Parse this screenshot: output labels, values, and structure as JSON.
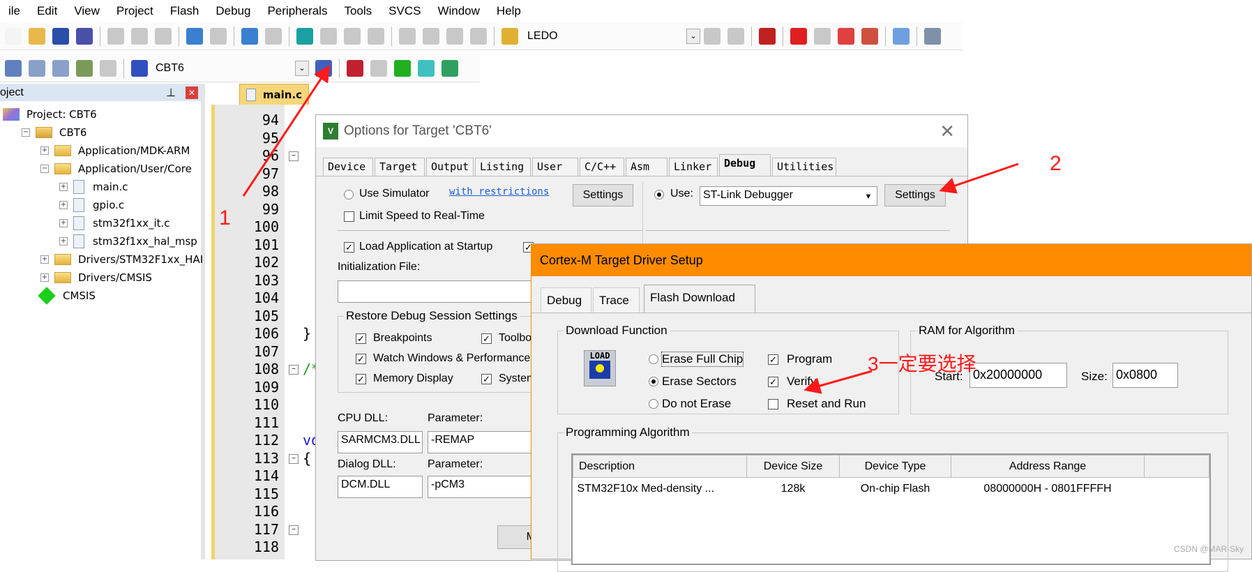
{
  "menu": [
    "ile",
    "Edit",
    "View",
    "Project",
    "Flash",
    "Debug",
    "Peripherals",
    "Tools",
    "SVCS",
    "Window",
    "Help"
  ],
  "toolbar1": {
    "icons": [
      "new-file-icon",
      "open-icon",
      "save-icon",
      "save-all-icon",
      "|",
      "cut-icon",
      "copy-icon",
      "paste-icon",
      "|",
      "undo-icon",
      "redo-icon",
      "|",
      "back-icon",
      "forward-icon",
      "|",
      "bookmark-icon",
      "prev-bookmark-icon",
      "next-bookmark-icon",
      "clear-bookmarks-icon",
      "|",
      "indent-icon",
      "unindent-icon",
      "comment-icon",
      "uncomment-icon",
      "|",
      "find-in-files-icon"
    ],
    "search_value": "LEDO",
    "right_icons": [
      "find-icon",
      "incremental-find-icon",
      "|",
      "debug-session-icon",
      "|",
      "breakpoint-icon",
      "disable-breakpoint-icon",
      "disable-all-breakpoints-icon",
      "kill-breakpoints-icon",
      "|",
      "window-layout-icon",
      "|",
      "configure-icon"
    ]
  },
  "toolbar2": {
    "icons": [
      "translate-icon",
      "build-icon",
      "rebuild-icon",
      "batch-build-icon",
      "stop-build-icon",
      "|",
      "load-icon"
    ],
    "target": "CBT6",
    "right_icons": [
      "options-for-target-icon",
      "|",
      "manage-project-items-icon",
      "select-packs-icon",
      "manage-rte-icon",
      "event-recorder-icon",
      "pack-installer-icon"
    ]
  },
  "project": {
    "title": "oject",
    "items": [
      {
        "label": "Project: CBT6",
        "level": 0,
        "type": "project"
      },
      {
        "label": "CBT6",
        "level": 1,
        "type": "target",
        "expand": "-"
      },
      {
        "label": "Application/MDK-ARM",
        "level": 2,
        "type": "folder",
        "expand": "+"
      },
      {
        "label": "Application/User/Core",
        "level": 2,
        "type": "folder",
        "expand": "-"
      },
      {
        "label": "main.c",
        "level": 3,
        "type": "file",
        "expand": "+"
      },
      {
        "label": "gpio.c",
        "level": 3,
        "type": "file",
        "expand": "+"
      },
      {
        "label": "stm32f1xx_it.c",
        "level": 3,
        "type": "file",
        "expand": "+"
      },
      {
        "label": "stm32f1xx_hal_msp",
        "level": 3,
        "type": "file",
        "expand": "+"
      },
      {
        "label": "Drivers/STM32F1xx_HAI",
        "level": 2,
        "type": "folder",
        "expand": "+"
      },
      {
        "label": "Drivers/CMSIS",
        "level": 2,
        "type": "folder",
        "expand": "+"
      },
      {
        "label": "CMSIS",
        "level": 2,
        "type": "component"
      }
    ]
  },
  "editor": {
    "tab": "main.c",
    "line_numbers": [
      "94",
      "95",
      "96",
      "97",
      "98",
      "99",
      "100",
      "101",
      "102",
      "103",
      "104",
      "105",
      "106",
      "107",
      "108",
      "109",
      "110",
      "111",
      "112",
      "113",
      "114",
      "115",
      "116",
      "117",
      "118"
    ],
    "fold_lines": [
      "96",
      "108",
      "113",
      "117"
    ],
    "code": {
      "106": "}",
      "108": "/*",
      "112": "vo",
      "113": "{"
    }
  },
  "options_dialog": {
    "title": "Options for Target 'CBT6'",
    "tabs": [
      "Device",
      "Target",
      "Output",
      "Listing",
      "User",
      "C/C++",
      "Asm",
      "Linker",
      "Debug",
      "Utilities"
    ],
    "active_tab": "Debug",
    "use_simulator": "Use Simulator",
    "with_restrictions": "with restrictions",
    "settings": "Settings",
    "limit_speed": "Limit Speed to Real-Time",
    "use": "Use:",
    "debugger": "ST-Link Debugger",
    "load_app": "Load Application at Startup",
    "init_file": "Initialization File:",
    "restore_group": "Restore Debug Session Settings",
    "restore_items": [
      "Breakpoints",
      "Toolbo",
      "Watch Windows & Performance",
      "Memory Display",
      "System"
    ],
    "cpu_dll_label": "CPU DLL:",
    "cpu_dll": "SARMCM3.DLL",
    "parameter_label": "Parameter:",
    "cpu_param": "-REMAP",
    "dialog_dll_label": "Dialog DLL:",
    "dialog_dll": "DCM.DLL",
    "dialog_param": "-pCM3",
    "partial_button": "M"
  },
  "driver_dialog": {
    "title": "Cortex-M Target Driver Setup",
    "tabs": [
      "Debug",
      "Trace",
      "Flash Download"
    ],
    "active_tab": "Flash Download",
    "download_function": "Download Function",
    "load_icon_text": "LOAD",
    "erase_options": [
      "Erase Full Chip",
      "Erase Sectors",
      "Do not Erase"
    ],
    "erase_selected": "Erase Sectors",
    "checks": [
      {
        "label": "Program",
        "checked": true
      },
      {
        "label": "Verify",
        "checked": true
      },
      {
        "label": "Reset and Run",
        "checked": false
      }
    ],
    "ram_group": "RAM for Algorithm",
    "start_label": "Start:",
    "start": "0x20000000",
    "size_label": "Size:",
    "size": "0x0800",
    "prog_group": "Programming Algorithm",
    "columns": [
      "Description",
      "Device Size",
      "Device Type",
      "Address Range"
    ],
    "rows": [
      [
        "STM32F10x Med-density ...",
        "128k",
        "On-chip Flash",
        "08000000H - 0801FFFFH"
      ]
    ]
  },
  "annotations": {
    "one": "1",
    "two": "2",
    "three": "3一定要选择",
    "color": "#ff1a1a"
  },
  "watermark": "CSDN @MAR-Sky"
}
